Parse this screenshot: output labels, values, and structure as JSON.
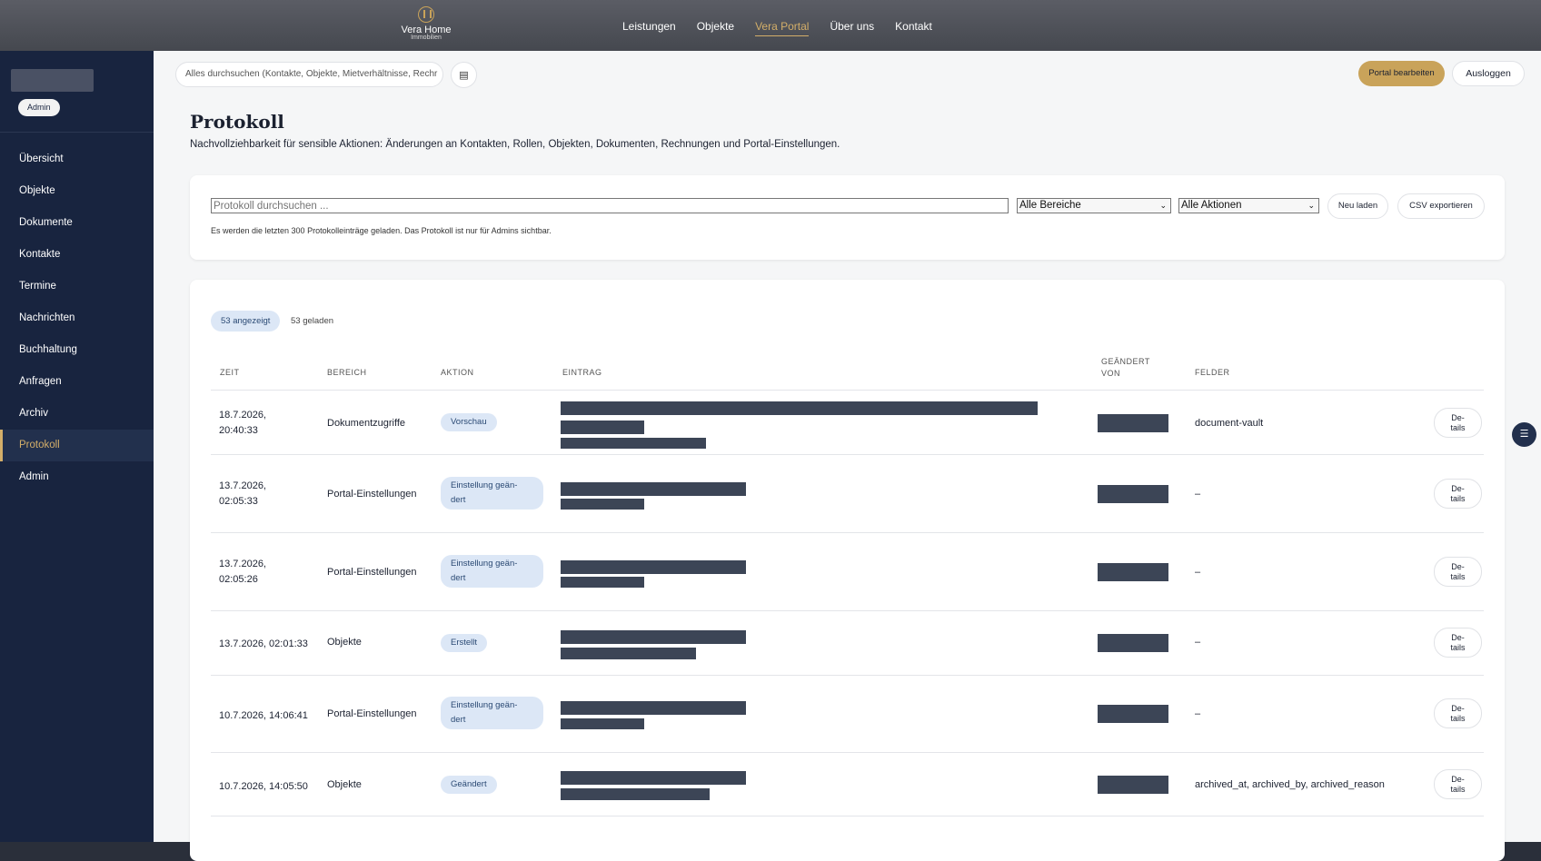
{
  "topbar": {
    "brand_name": "Vera Home",
    "brand_sub": "Immobilien",
    "nav": [
      "Leistungen",
      "Objekte",
      "Vera Portal",
      "Über uns",
      "Kontakt"
    ],
    "active_nav": "Vera Portal"
  },
  "sidebar": {
    "role": "Admin",
    "items": [
      "Übersicht",
      "Objekte",
      "Dokumente",
      "Kontakte",
      "Termine",
      "Nachrichten",
      "Buchhaltung",
      "Anfragen",
      "Archiv",
      "Protokoll",
      "Admin"
    ],
    "active": "Protokoll"
  },
  "header": {
    "search_placeholder": "Alles durchsuchen (Kontakte, Objekte, Mietverhältnisse, Rechr",
    "edit_label": "Portal bearbeiten",
    "logout_label": "Ausloggen"
  },
  "page": {
    "title": "Protokoll",
    "subtitle": "Nachvollziehbarkeit für sensible Aktionen: Änderungen an Kontakten, Rollen, Objekten, Dokumenten, Rechnungen und Portal-Einstellungen."
  },
  "filters": {
    "search_placeholder": "Protokoll durchsuchen ...",
    "area_select": "Alle Bereiche",
    "action_select": "Alle Aktionen",
    "reload_label": "Neu laden",
    "export_label": "CSV exportieren",
    "note": "Es werden die letzten 300 Protokolleinträge geladen. Das Protokoll ist nur für Admins sichtbar."
  },
  "table": {
    "shown": "53 angezeigt",
    "loaded": "53 geladen",
    "headers": {
      "time": "ZEIT",
      "area": "BEREICH",
      "action": "AKTION",
      "entry": "EINTRAG",
      "changed_by_1": "GEÄNDERT",
      "changed_by_2": "VON",
      "fields": "FELDER"
    },
    "details_1": "De-",
    "details_2": "tails",
    "rows": [
      {
        "time_1": "18.7.2026,",
        "time_2": "20:40:33",
        "area": "Dokumentzugriffe",
        "action_1": "Vorschau",
        "action_2": "",
        "fields": "document-vault"
      },
      {
        "time_1": "13.7.2026,",
        "time_2": "02:05:33",
        "area": "Portal-Einstellungen",
        "action_1": "Einstellung geän-",
        "action_2": "dert",
        "fields": "–"
      },
      {
        "time_1": "13.7.2026,",
        "time_2": "02:05:26",
        "area": "Portal-Einstellungen",
        "action_1": "Einstellung geän-",
        "action_2": "dert",
        "fields": "–"
      },
      {
        "time_1": "13.7.2026, 02:01:33",
        "time_2": "",
        "area": "Objekte",
        "action_1": "Erstellt",
        "action_2": "",
        "fields": "–"
      },
      {
        "time_1": "10.7.2026, 14:06:41",
        "time_2": "",
        "area": "Portal-Einstellungen",
        "action_1": "Einstellung geän-",
        "action_2": "dert",
        "fields": "–"
      },
      {
        "time_1": "10.7.2026, 14:05:50",
        "time_2": "",
        "area": "Objekte",
        "action_1": "Geändert",
        "action_2": "",
        "fields": "archived_at, archived_by, archived_reason"
      }
    ]
  },
  "colors": {
    "accent": "#d3ae69",
    "sidebar": "#18243f",
    "badge": "#dce7f6"
  }
}
